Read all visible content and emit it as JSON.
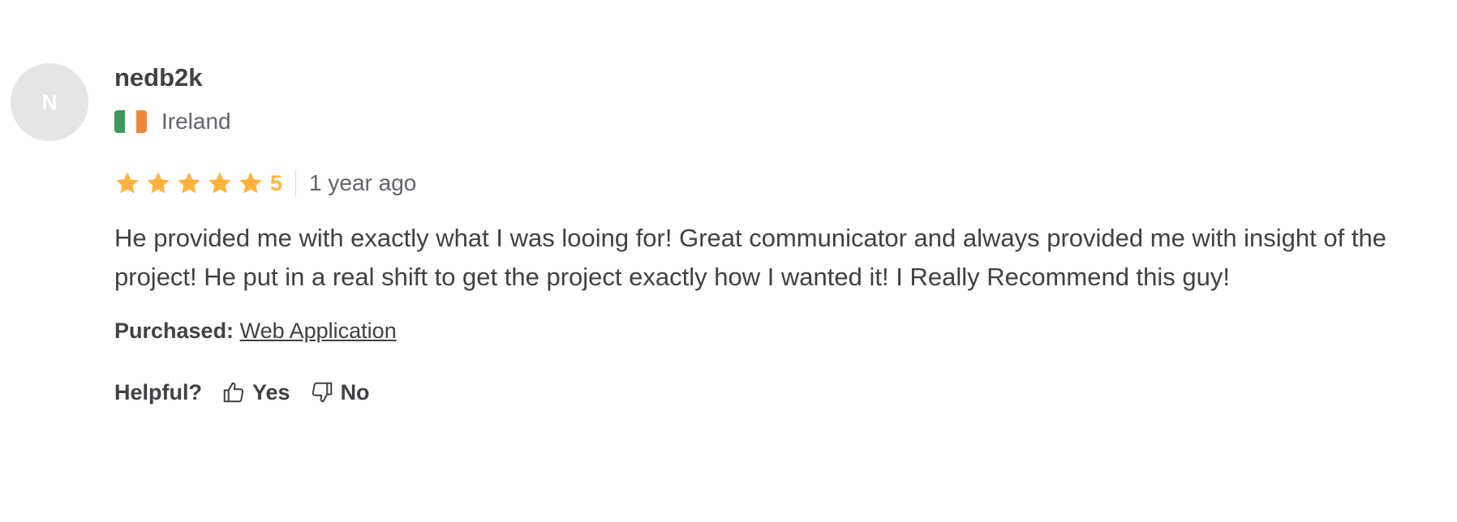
{
  "review": {
    "avatar_initial": "N",
    "username": "nedb2k",
    "country": "Ireland",
    "flag_colors": [
      "#3a9a5f",
      "#ffffff",
      "#f0873c"
    ],
    "rating": {
      "value": "5",
      "stars_filled": 5,
      "stars_total": 5,
      "star_color": "#ffb33e"
    },
    "time_ago": "1 year ago",
    "text": "He provided me with exactly what I was looing for! Great communicator and always provided me with insight of the project! He put in a real shift to get the project exactly how I wanted it! I Really Recommend this guy!",
    "purchased_label": "Purchased:",
    "purchased_item": "Web Application",
    "helpful_label": "Helpful?",
    "yes_label": "Yes",
    "no_label": "No",
    "icons": {
      "flag": "ireland-flag-icon",
      "star": "star-icon",
      "yes": "thumbs-up-icon",
      "no": "thumbs-down-icon"
    }
  }
}
